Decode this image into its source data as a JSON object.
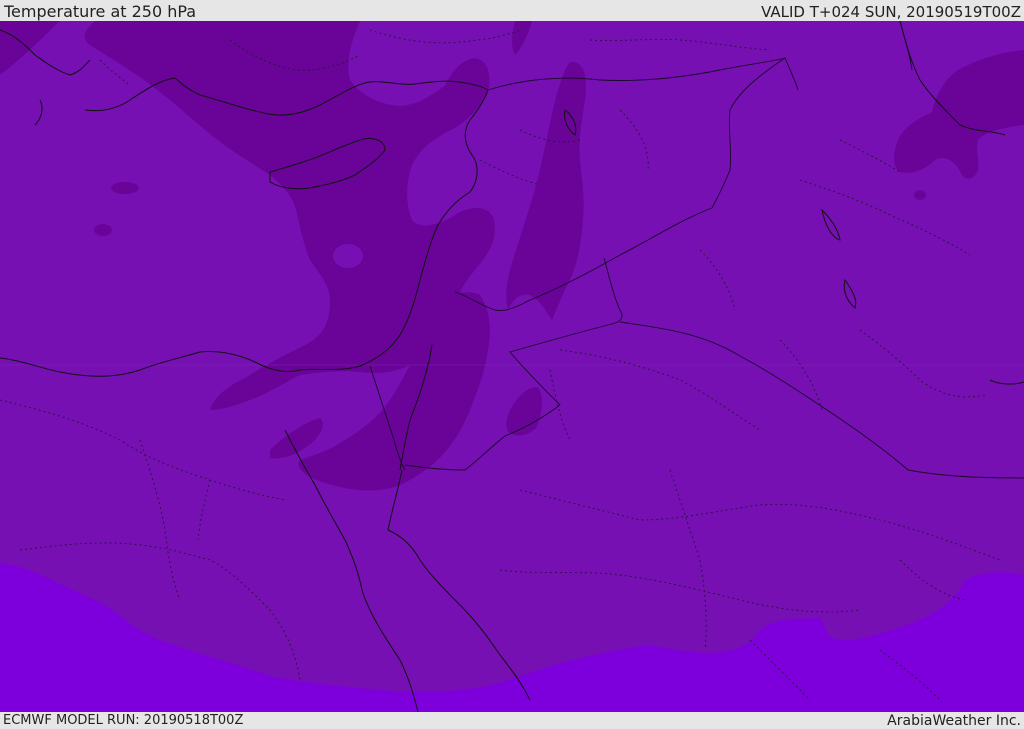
{
  "header": {
    "title": "Temperature at 250 hPa",
    "valid": "VALID T+024 SUN, 20190519T00Z"
  },
  "footer": {
    "model_run": "ECMWF MODEL RUN: 20190518T00Z",
    "credit": "ArabiaWeather Inc."
  },
  "map": {
    "field": "temperature",
    "level": "250 hPa",
    "colors": {
      "warm_band": "#7D00DC",
      "mid_band": "#7610B2",
      "cold_band": "#6A0498",
      "coast_line": "#111111",
      "border_line": "#1a0a2a"
    }
  }
}
